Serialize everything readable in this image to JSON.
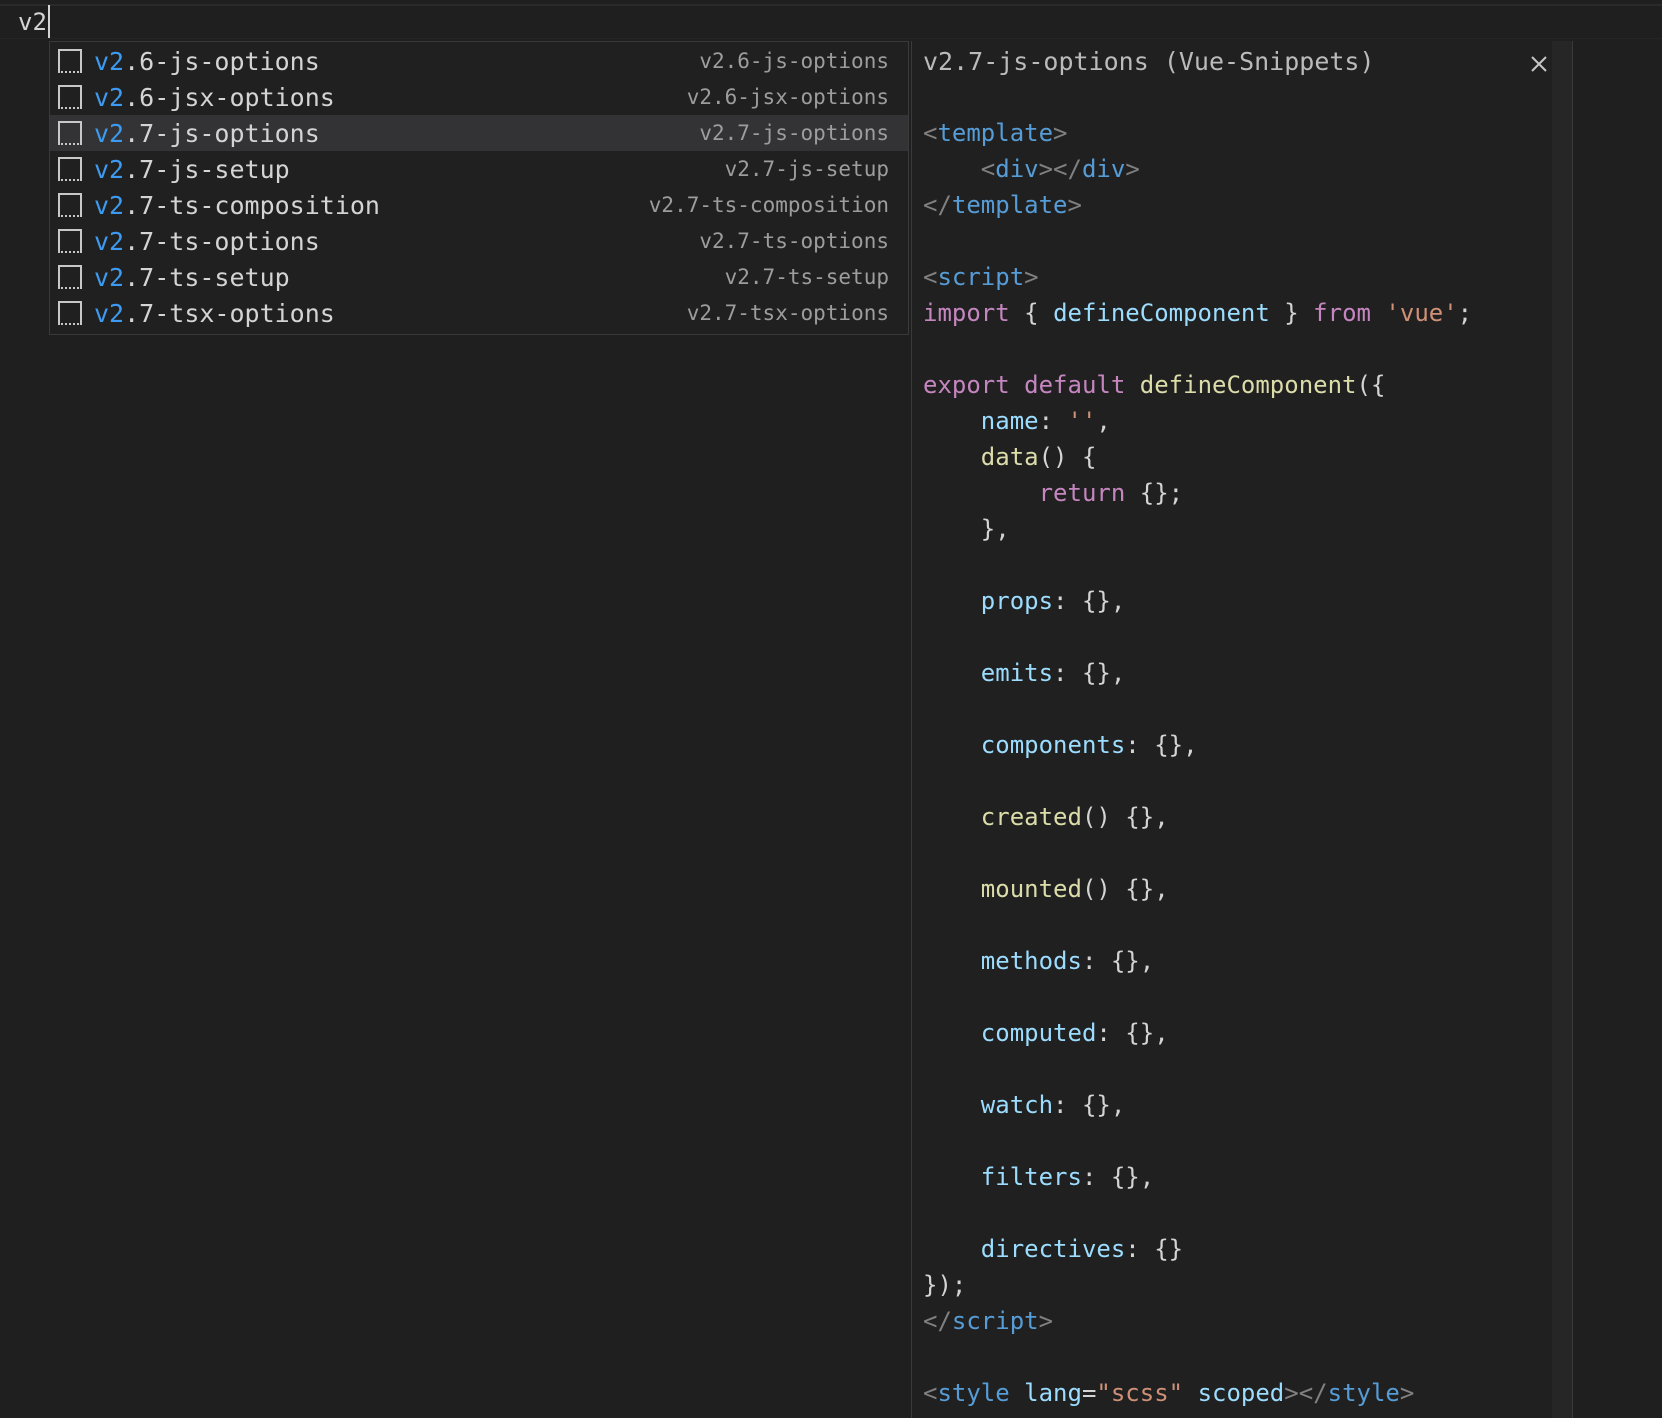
{
  "editor": {
    "typed_text": "v2"
  },
  "suggestions": {
    "match_prefix": "v2",
    "selected_index": 2,
    "items": [
      {
        "label_rest": ".6-js-options",
        "detail": "v2.6-js-options"
      },
      {
        "label_rest": ".6-jsx-options",
        "detail": "v2.6-jsx-options"
      },
      {
        "label_rest": ".7-js-options",
        "detail": "v2.7-js-options"
      },
      {
        "label_rest": ".7-js-setup",
        "detail": "v2.7-js-setup"
      },
      {
        "label_rest": ".7-ts-composition",
        "detail": "v2.7-ts-composition"
      },
      {
        "label_rest": ".7-ts-options",
        "detail": "v2.7-ts-options"
      },
      {
        "label_rest": ".7-ts-setup",
        "detail": "v2.7-ts-setup"
      },
      {
        "label_rest": ".7-tsx-options",
        "detail": "v2.7-tsx-options"
      }
    ],
    "item_icon": "snippet-icon"
  },
  "details": {
    "title": "v2.7-js-options (Vue-Snippets)",
    "close_icon": "close-icon",
    "code_lines": [
      [
        [
          "p",
          "<"
        ],
        [
          "g",
          "template"
        ],
        [
          "p",
          ">"
        ]
      ],
      [
        [
          "x",
          "    "
        ],
        [
          "p",
          "<"
        ],
        [
          "g",
          "div"
        ],
        [
          "p",
          "></"
        ],
        [
          "g",
          "div"
        ],
        [
          "p",
          ">"
        ]
      ],
      [
        [
          "p",
          "</"
        ],
        [
          "g",
          "template"
        ],
        [
          "p",
          ">"
        ]
      ],
      [],
      [
        [
          "p",
          "<"
        ],
        [
          "g",
          "script"
        ],
        [
          "p",
          ">"
        ]
      ],
      [
        [
          "k",
          "import"
        ],
        [
          "x",
          " { "
        ],
        [
          "i",
          "defineComponent"
        ],
        [
          "x",
          " } "
        ],
        [
          "k",
          "from"
        ],
        [
          "x",
          " "
        ],
        [
          "s",
          "'vue'"
        ],
        [
          "x",
          ";"
        ]
      ],
      [],
      [
        [
          "k",
          "export"
        ],
        [
          "x",
          " "
        ],
        [
          "k",
          "default"
        ],
        [
          "x",
          " "
        ],
        [
          "f",
          "defineComponent"
        ],
        [
          "x",
          "({"
        ]
      ],
      [
        [
          "x",
          "    "
        ],
        [
          "i",
          "name"
        ],
        [
          "x",
          ": "
        ],
        [
          "s",
          "''"
        ],
        [
          "x",
          ","
        ]
      ],
      [
        [
          "x",
          "    "
        ],
        [
          "f",
          "data"
        ],
        [
          "x",
          "() {"
        ]
      ],
      [
        [
          "x",
          "        "
        ],
        [
          "k",
          "return"
        ],
        [
          "x",
          " {};"
        ]
      ],
      [
        [
          "x",
          "    },"
        ]
      ],
      [],
      [
        [
          "x",
          "    "
        ],
        [
          "i",
          "props"
        ],
        [
          "x",
          ": {},"
        ]
      ],
      [],
      [
        [
          "x",
          "    "
        ],
        [
          "i",
          "emits"
        ],
        [
          "x",
          ": {},"
        ]
      ],
      [],
      [
        [
          "x",
          "    "
        ],
        [
          "i",
          "components"
        ],
        [
          "x",
          ": {},"
        ]
      ],
      [],
      [
        [
          "x",
          "    "
        ],
        [
          "f",
          "created"
        ],
        [
          "x",
          "() {},"
        ]
      ],
      [],
      [
        [
          "x",
          "    "
        ],
        [
          "f",
          "mounted"
        ],
        [
          "x",
          "() {},"
        ]
      ],
      [],
      [
        [
          "x",
          "    "
        ],
        [
          "i",
          "methods"
        ],
        [
          "x",
          ": {},"
        ]
      ],
      [],
      [
        [
          "x",
          "    "
        ],
        [
          "i",
          "computed"
        ],
        [
          "x",
          ": {},"
        ]
      ],
      [],
      [
        [
          "x",
          "    "
        ],
        [
          "i",
          "watch"
        ],
        [
          "x",
          ": {},"
        ]
      ],
      [],
      [
        [
          "x",
          "    "
        ],
        [
          "i",
          "filters"
        ],
        [
          "x",
          ": {},"
        ]
      ],
      [],
      [
        [
          "x",
          "    "
        ],
        [
          "i",
          "directives"
        ],
        [
          "x",
          ": {}"
        ]
      ],
      [
        [
          "x",
          "});"
        ]
      ],
      [
        [
          "p",
          "</"
        ],
        [
          "g",
          "script"
        ],
        [
          "p",
          ">"
        ]
      ],
      [],
      [
        [
          "p",
          "<"
        ],
        [
          "g",
          "style"
        ],
        [
          "x",
          " "
        ],
        [
          "i",
          "lang"
        ],
        [
          "x",
          "="
        ],
        [
          "s",
          "\"scss\""
        ],
        [
          "x",
          " "
        ],
        [
          "i",
          "scoped"
        ],
        [
          "p",
          "></"
        ],
        [
          "g",
          "style"
        ],
        [
          "p",
          ">"
        ]
      ]
    ]
  },
  "colors": {
    "background": "#1f1f1f",
    "match_highlight": "#3c9bf0",
    "selected_row": "#333335",
    "tag": "#569cd6",
    "keyword": "#c586c0",
    "identifier": "#9cdcfe",
    "function": "#dcdcaa",
    "string": "#ce9178"
  }
}
